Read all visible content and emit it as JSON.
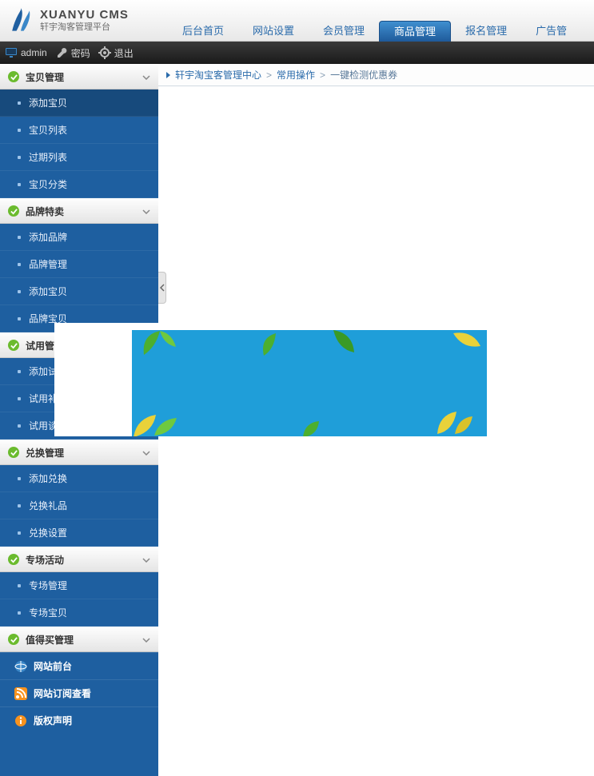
{
  "brand": {
    "title": "XUANYU CMS",
    "subtitle": "轩宇淘客管理平台"
  },
  "topbar": {
    "admin": "admin",
    "password": "密码",
    "logout": "退出"
  },
  "tabs": [
    {
      "label": "后台首页"
    },
    {
      "label": "网站设置"
    },
    {
      "label": "会员管理"
    },
    {
      "label": "商品管理",
      "active": true
    },
    {
      "label": "报名管理"
    },
    {
      "label": "广告管"
    }
  ],
  "breadcrumb": {
    "root": "轩宇淘宝客管理中心",
    "sep": ">",
    "mid": "常用操作",
    "leaf": "一键检测优惠券"
  },
  "sidebar": {
    "sections": [
      {
        "title": "宝贝管理",
        "items": [
          "添加宝贝",
          "宝贝列表",
          "过期列表",
          "宝贝分类"
        ],
        "activeIndex": 0
      },
      {
        "title": "品牌特卖",
        "items": [
          "添加品牌",
          "品牌管理",
          "添加宝贝",
          "品牌宝贝"
        ]
      },
      {
        "title": "试用管",
        "items": [
          "添加试",
          "试用补",
          "试用谈"
        ]
      },
      {
        "title": "兑换管理",
        "items": [
          "添加兑换",
          "兑换礼品",
          "兑换设置"
        ]
      },
      {
        "title": "专场活动",
        "items": [
          "专场管理",
          "专场宝贝"
        ]
      },
      {
        "title": "值得买管理",
        "items": []
      }
    ],
    "bottomLinks": {
      "frontend": "网站前台",
      "rss": "网站订阅查看",
      "copyright": "版权声明"
    }
  }
}
